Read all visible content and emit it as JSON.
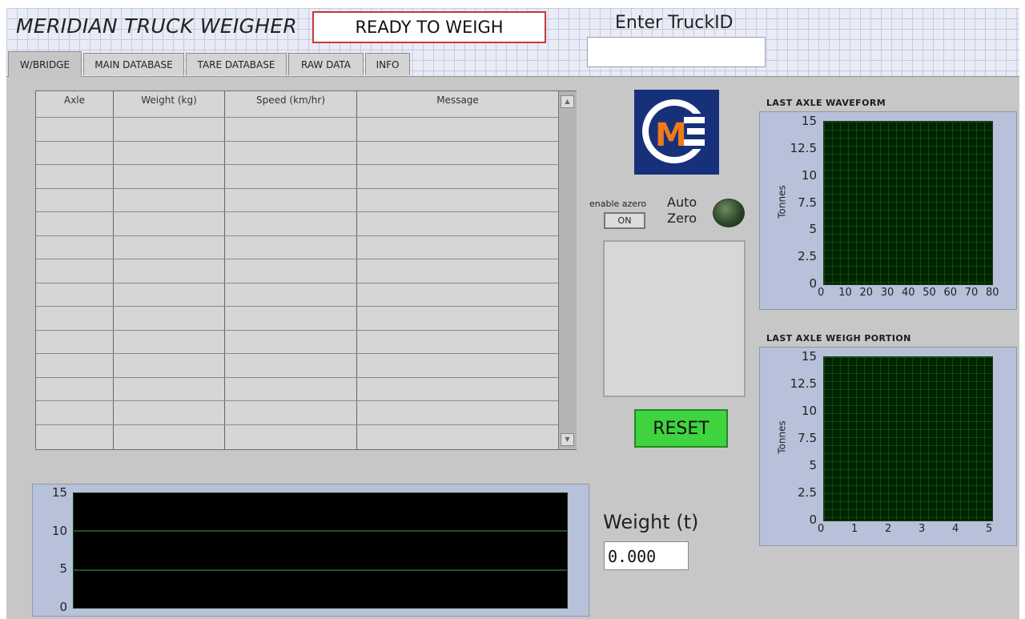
{
  "app": {
    "title": "MERIDIAN TRUCK WEIGHER",
    "status": "READY TO WEIGH"
  },
  "truck": {
    "label": "Enter TruckID",
    "value": ""
  },
  "tabs": [
    {
      "label": "W/BRIDGE",
      "active": true
    },
    {
      "label": "MAIN DATABASE",
      "active": false
    },
    {
      "label": "TARE DATABASE",
      "active": false
    },
    {
      "label": "RAW DATA",
      "active": false
    },
    {
      "label": "INFO",
      "active": false
    }
  ],
  "table": {
    "columns": [
      "Axle",
      "Weight (kg)",
      "Speed (km/hr)",
      "Message"
    ],
    "rows": []
  },
  "logo": {
    "text": "M",
    "icon": "meridian-logo"
  },
  "autozero": {
    "enable_label": "enable azero",
    "button": "ON",
    "label_line1": "Auto",
    "label_line2": "Zero",
    "led_on": false
  },
  "reset": {
    "label": "RESET"
  },
  "weight": {
    "label": "Weight (t)",
    "value": "0.000"
  },
  "colors": {
    "reset_green": "#3fd43f",
    "plot_bg": "#022202",
    "plot_grid": "#0a4d10",
    "trace": "#3aa83a",
    "status_border": "#c23a3a",
    "logo_navy": "#16317a",
    "logo_orange": "#f07a1a"
  },
  "chart_data": [
    {
      "type": "line",
      "title": "LAST AXLE WAVEFORM",
      "ylabel": "Tonnes",
      "xlabel": "",
      "xlim": [
        0,
        80
      ],
      "ylim": [
        0,
        15
      ],
      "xticks": [
        "0",
        "10",
        "20",
        "30",
        "40",
        "50",
        "60",
        "70",
        "80"
      ],
      "yticks": [
        "0",
        "2.5",
        "5",
        "7.5",
        "10",
        "12.5",
        "15"
      ],
      "series": []
    },
    {
      "type": "line",
      "title": "LAST AXLE WEIGH PORTION",
      "ylabel": "Tonnes",
      "xlabel": "",
      "xlim": [
        0,
        5
      ],
      "ylim": [
        0,
        15
      ],
      "xticks": [
        "0",
        "1",
        "2",
        "3",
        "4",
        "5"
      ],
      "yticks": [
        "0",
        "2.5",
        "5",
        "7.5",
        "10",
        "12.5",
        "15"
      ],
      "series": []
    },
    {
      "type": "line",
      "title": "",
      "ylabel": "",
      "xlabel": "",
      "ylim": [
        0,
        15
      ],
      "yticks": [
        "0",
        "5",
        "10",
        "15"
      ],
      "series": []
    }
  ]
}
